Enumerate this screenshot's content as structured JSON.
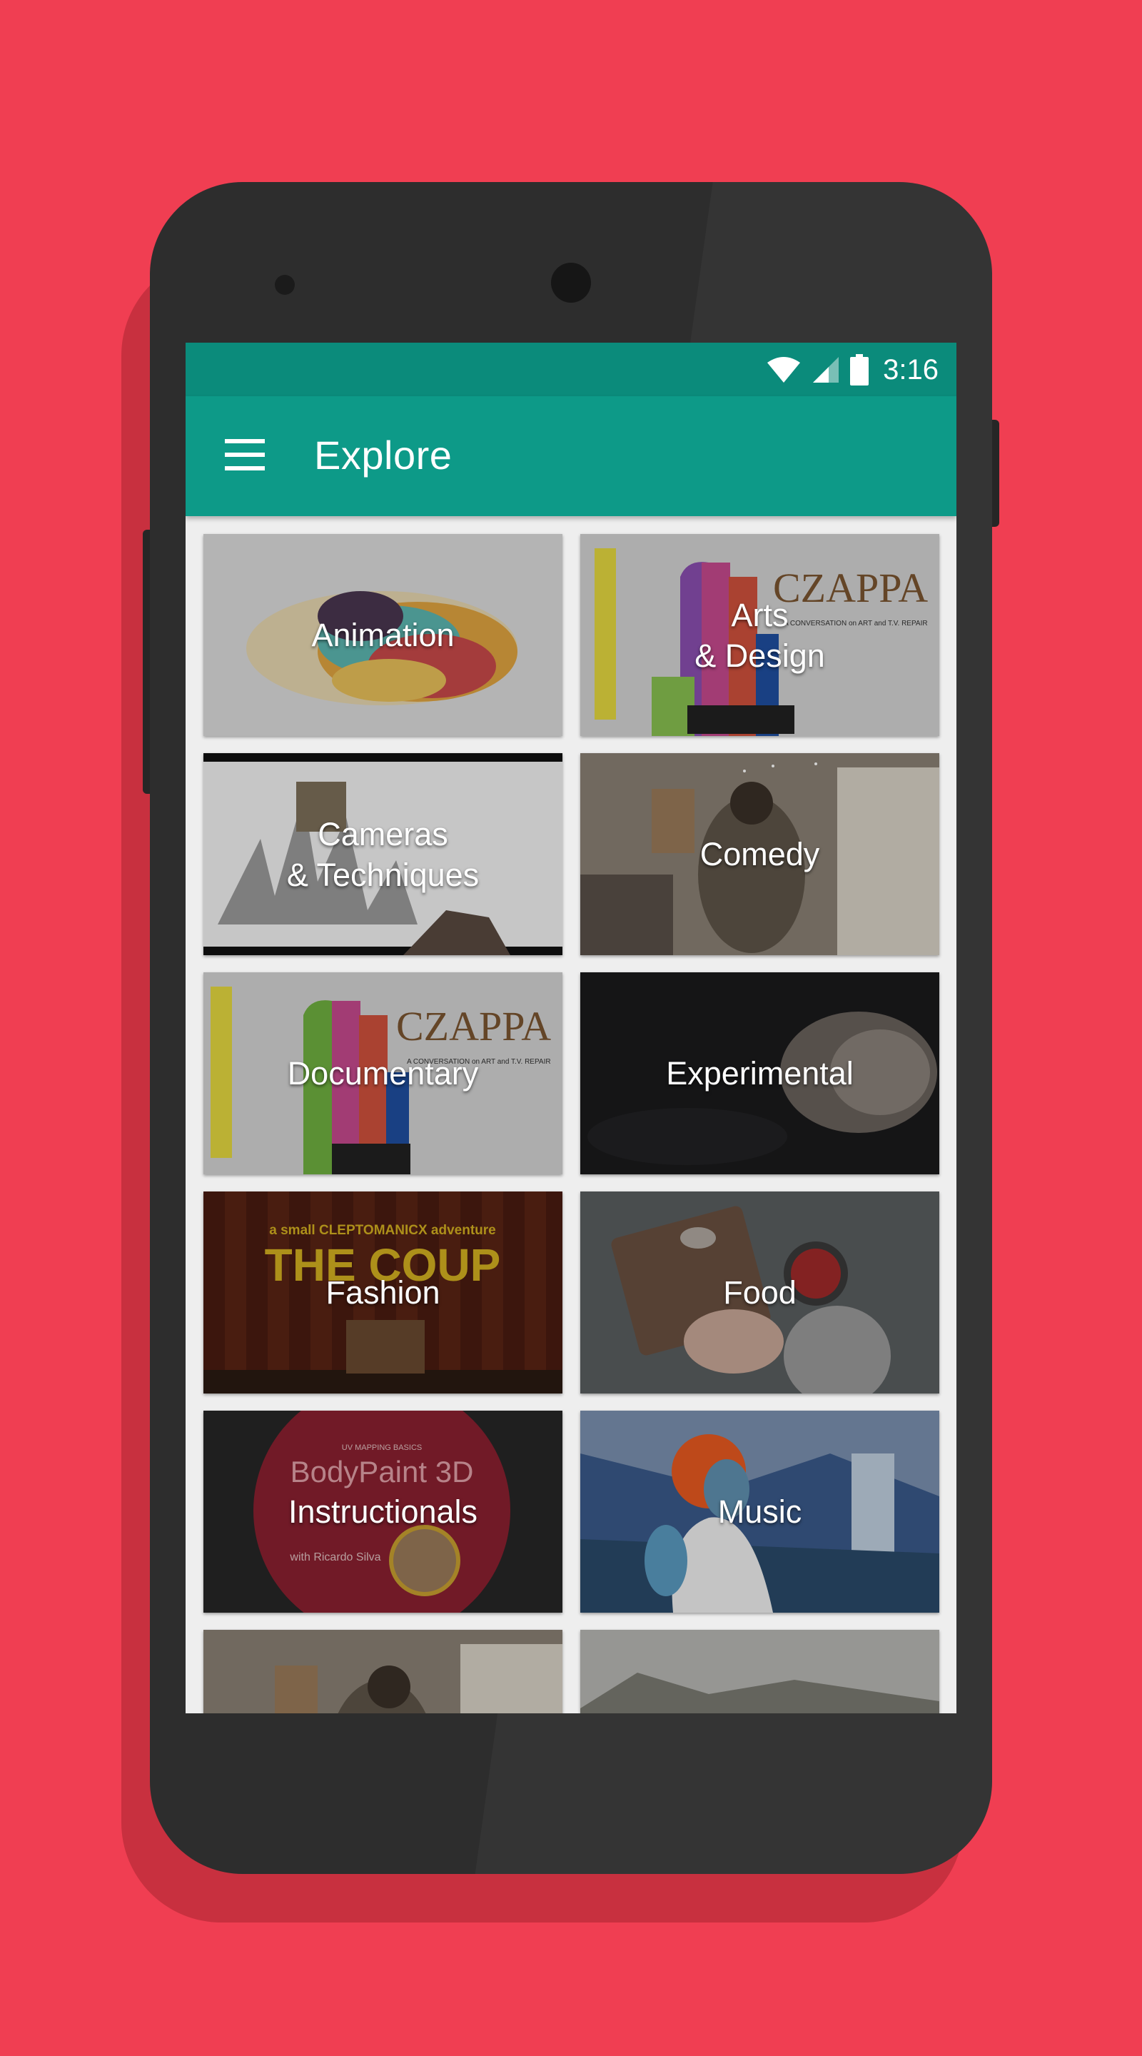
{
  "status_bar": {
    "time": "3:16",
    "icons": [
      "wifi-icon",
      "cellular-signal-icon",
      "battery-icon"
    ]
  },
  "app_bar": {
    "menu_icon": "hamburger-menu-icon",
    "title": "Explore",
    "color": "#0d9a88"
  },
  "categories": [
    {
      "label": "Animation"
    },
    {
      "label": "Arts\n& Design"
    },
    {
      "label": "Cameras\n& Techniques"
    },
    {
      "label": "Comedy"
    },
    {
      "label": "Documentary"
    },
    {
      "label": "Experimental"
    },
    {
      "label": "Fashion"
    },
    {
      "label": "Food"
    },
    {
      "label": "Instructionals"
    },
    {
      "label": "Music"
    },
    {
      "label": ""
    },
    {
      "label": ""
    }
  ],
  "thumbnail_text": {
    "czappa_title": "CZAPPA",
    "czappa_subtitle": "A CONVERSATION on ART and T.V. REPAIR",
    "coup_tagline": "a small CLEPTOMANICX adventure",
    "coup_title": "THE COUP",
    "bodypaint_kicker": "UV MAPPING BASICS",
    "bodypaint_title": "BodyPaint 3D",
    "bodypaint_author": "with Ricardo Silva"
  },
  "colors": {
    "background": "#f03e52",
    "status_bar": "#0b8b7b",
    "app_bar": "#0d9a88"
  }
}
